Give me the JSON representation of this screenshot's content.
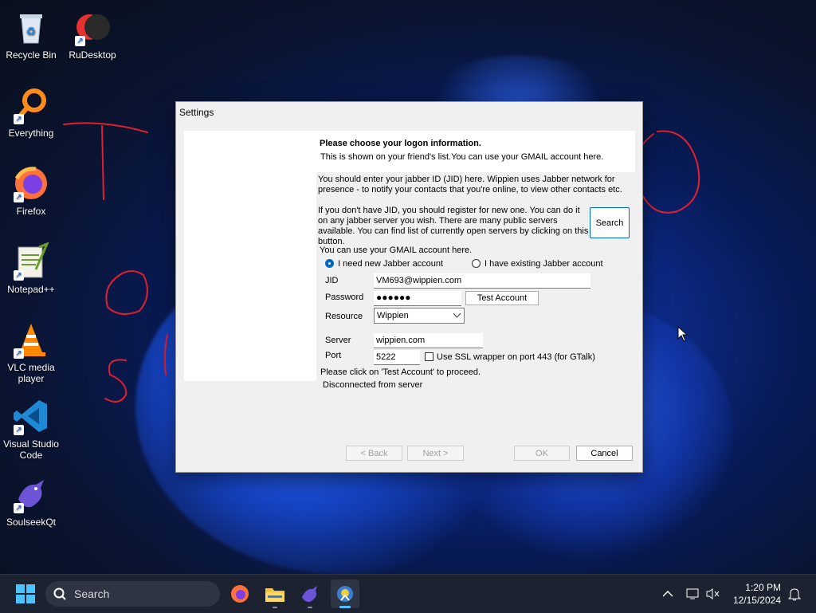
{
  "desktop": {
    "icons": [
      {
        "label": "Recycle Bin"
      },
      {
        "label": "RuDesktop"
      },
      {
        "label": "Everything"
      },
      {
        "label": "Firefox"
      },
      {
        "label": "Notepad++"
      },
      {
        "label": "VLC media player"
      },
      {
        "label": "Visual Studio Code"
      },
      {
        "label": "SoulseekQt"
      }
    ]
  },
  "dialog": {
    "title": "Settings",
    "header_title": "Please choose your logon information.",
    "header_subtitle": "This is shown on your friend's list.You can use your GMAIL account here.",
    "para1": "You should enter your jabber ID (JID) here. Wippien uses Jabber network for presence - to notify your contacts that you're online, to view other contacts etc.",
    "para2": "If you don't have JID, you should register for new one. You can do it on any jabber server you wish. There are many public servers available. You can find list of currently open servers by clicking on this button.",
    "search_button": "Search",
    "gmail_note": "You can use your GMAIL account here.",
    "radio_new": "I need new Jabber account",
    "radio_existing": "I have existing Jabber account",
    "jid_label": "JID",
    "jid_value": "VM693@wippien.com",
    "password_label": "Password",
    "password_value": "●●●●●●",
    "test_account_button": "Test Account",
    "resource_label": "Resource",
    "resource_value": "Wippien",
    "server_label": "Server",
    "server_value": "wippien.com",
    "port_label": "Port",
    "port_value": "5222",
    "ssl_label": "Use SSL wrapper on port 443 (for GTalk)",
    "hint": "Please click on 'Test Account' to proceed.",
    "status": "Disconnected from server",
    "back_button": "< Back",
    "next_button": "Next >",
    "ok_button": "OK",
    "cancel_button": "Cancel"
  },
  "taskbar": {
    "search_placeholder": "Search",
    "time": "1:20 PM",
    "date": "12/15/2024"
  },
  "colors": {
    "accent": "#0067c0",
    "taskbar": "#1c2230",
    "annotation_red": "#e02030"
  }
}
